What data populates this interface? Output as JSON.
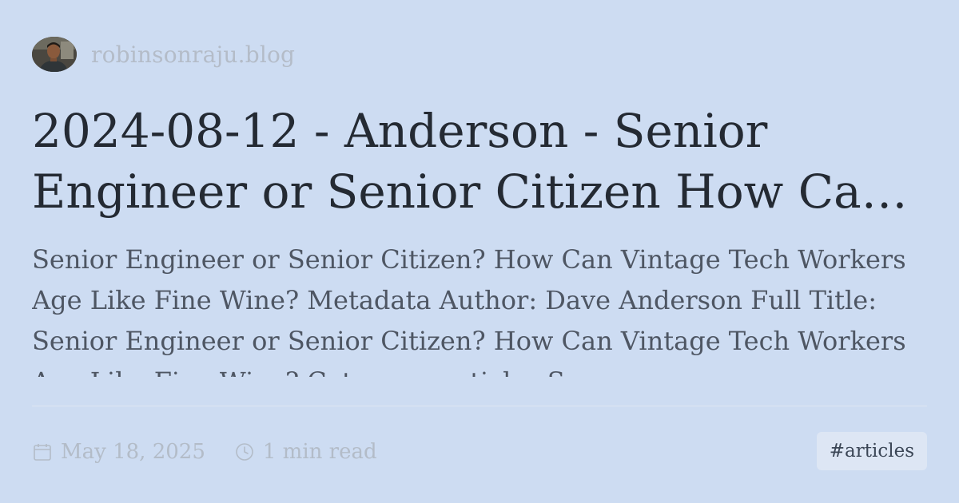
{
  "site": {
    "name": "robinsonraju.blog",
    "avatar_icon": "author-avatar-photo"
  },
  "post": {
    "title": "2024-08-12 - Anderson - Senior Engineer or Senior Citizen How Can Vintage Tech Workers Age Like Fine Wine",
    "excerpt": "Senior Engineer or Senior Citizen? How Can Vintage Tech Workers Age Like Fine Wine? Metadata Author: Dave Anderson Full Title: Senior Engineer or Senior Citizen? How Can Vintage Tech Workers Age Like Fine Wine? Category: articles Summary:",
    "date": "May 18, 2025",
    "date_icon": "calendar-icon",
    "reading_time": "1 min read",
    "reading_time_icon": "clock-icon",
    "tag": "#articles"
  },
  "colors": {
    "background": "#cddcf2",
    "title": "#242a33",
    "excerpt": "#4e5663",
    "muted": "#b3bcc8",
    "tag_background": "#dde6f4"
  }
}
